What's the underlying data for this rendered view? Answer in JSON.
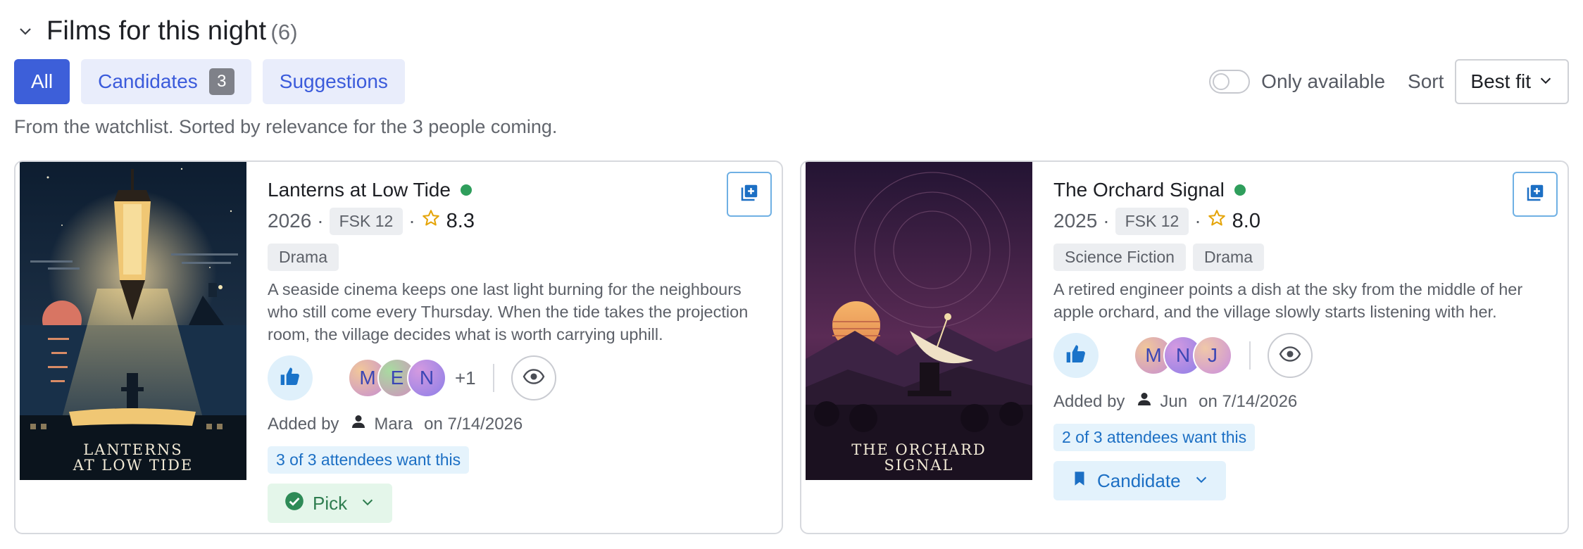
{
  "header": {
    "title": "Films for this night",
    "count": "(6)"
  },
  "filters": {
    "tabs": [
      {
        "label": "All",
        "active": true
      },
      {
        "label": "Candidates",
        "badge": "3"
      },
      {
        "label": "Suggestions"
      }
    ],
    "only_available_label": "Only available",
    "only_available_on": false,
    "sort_label": "Sort",
    "sort_value": "Best fit"
  },
  "subtitle": "From the watchlist. Sorted by relevance for the 3 people coming.",
  "films": [
    {
      "title": "Lanterns at Low Tide",
      "available": true,
      "year": "2026",
      "age_rating": "FSK 12",
      "rating": "8.3",
      "genres": [
        "Drama"
      ],
      "description": "A seaside cinema keeps one last light burning for the neighbours who still come every Thursday. When the tide takes the projection room, the village decides what is worth carrying uphill.",
      "poster_title_line1": "LANTERNS",
      "poster_title_line2": "AT LOW TIDE",
      "voters": [
        "M",
        "E",
        "N"
      ],
      "more_voters": "+1",
      "added_by_label": "Added by",
      "added_by": "Mara",
      "added_on": "on 7/14/2026",
      "want_text": "3 of 3 attendees want this",
      "status": "Pick"
    },
    {
      "title": "The Orchard Signal",
      "available": true,
      "year": "2025",
      "age_rating": "FSK 12",
      "rating": "8.0",
      "genres": [
        "Science Fiction",
        "Drama"
      ],
      "description": "A retired engineer points a dish at the sky from the middle of her apple orchard, and the village slowly starts listening with her.",
      "poster_title_line1": "THE ORCHARD",
      "poster_title_line2": "SIGNAL",
      "voters": [
        "M",
        "N",
        "J"
      ],
      "added_by_label": "Added by",
      "added_by": "Jun",
      "added_on": "on 7/14/2026",
      "want_text": "2 of 3 attendees want this",
      "status": "Candidate"
    }
  ],
  "colors": {
    "accent": "#3d5fd9",
    "available_dot": "#2f9e5c",
    "link_blue": "#1c6fc4",
    "star": "#e5a50a"
  },
  "icons": [
    "chevron-down-icon",
    "thumbs-up-icon",
    "eye-icon",
    "add-to-list-icon",
    "user-icon",
    "check-circle-icon",
    "bookmark-icon",
    "star-icon"
  ]
}
